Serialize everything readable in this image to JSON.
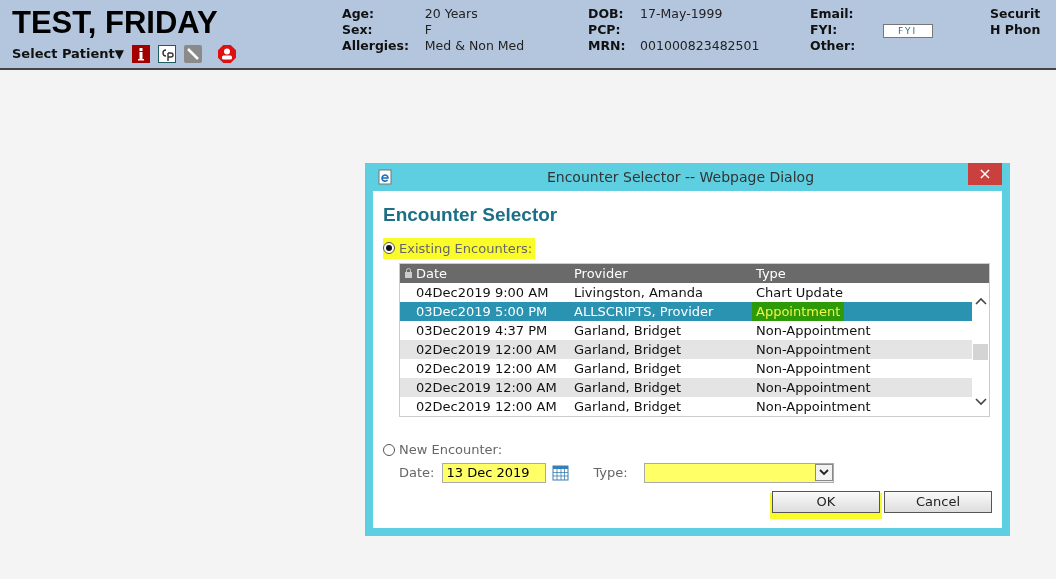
{
  "patient": {
    "name": "TEST, FRIDAY",
    "select_label": "Select Patient",
    "select_caret": "▼"
  },
  "demographics": [
    {
      "fields": [
        {
          "label": "Age:",
          "value": "20 Years"
        },
        {
          "label": "Sex:",
          "value": "F"
        },
        {
          "label": "Allergies:",
          "value": "Med & Non Med"
        }
      ]
    },
    {
      "fields": [
        {
          "label": "DOB:",
          "value": "17-May-1999"
        },
        {
          "label": "PCP:"
        },
        {
          "label": "MRN:",
          "value": "001000823482501"
        }
      ]
    },
    {
      "fields": [
        {
          "label": "Email:"
        },
        {
          "label": "FYI:",
          "button": "FYI"
        },
        {
          "label": "Other:"
        }
      ]
    },
    {
      "fields": [
        {
          "label": "Securit"
        },
        {
          "label": "H Phon"
        }
      ]
    }
  ],
  "dialog": {
    "window_title": "Encounter Selector -- Webpage Dialog",
    "close": "×",
    "heading": "Encounter Selector",
    "existing": {
      "label": "Existing Encounters:",
      "selected": true,
      "highlighted": true
    },
    "table": {
      "columns": [
        "Date",
        "Provider",
        "Type"
      ],
      "rows": [
        {
          "date": "04Dec2019 9:00 AM",
          "provider": "Livingston, Amanda",
          "type": "Chart Update",
          "selected": false,
          "highlighted": false
        },
        {
          "date": "03Dec2019 5:00 PM",
          "provider": "ALLSCRIPTS, Provider",
          "type": "Appointment",
          "selected": true,
          "highlighted": true
        },
        {
          "date": "03Dec2019 4:37 PM",
          "provider": "Garland, Bridget",
          "type": "Non-Appointment",
          "selected": false,
          "highlighted": false
        },
        {
          "date": "02Dec2019 12:00 AM",
          "provider": "Garland, Bridget",
          "type": "Non-Appointment",
          "selected": false,
          "highlighted": false
        },
        {
          "date": "02Dec2019 12:00 AM",
          "provider": "Garland, Bridget",
          "type": "Non-Appointment",
          "selected": false,
          "highlighted": false
        },
        {
          "date": "02Dec2019 12:00 AM",
          "provider": "Garland, Bridget",
          "type": "Non-Appointment",
          "selected": false,
          "highlighted": false
        },
        {
          "date": "02Dec2019 12:00 AM",
          "provider": "Garland, Bridget",
          "type": "Non-Appointment",
          "selected": false,
          "highlighted": false
        }
      ]
    },
    "new": {
      "label": "New Encounter:",
      "selected": false,
      "date_label": "Date:",
      "date_value": "13 Dec 2019",
      "type_label": "Type:"
    },
    "buttons": [
      {
        "label": "OK",
        "highlighted": true
      },
      {
        "label": "Cancel",
        "highlighted": false
      }
    ]
  }
}
